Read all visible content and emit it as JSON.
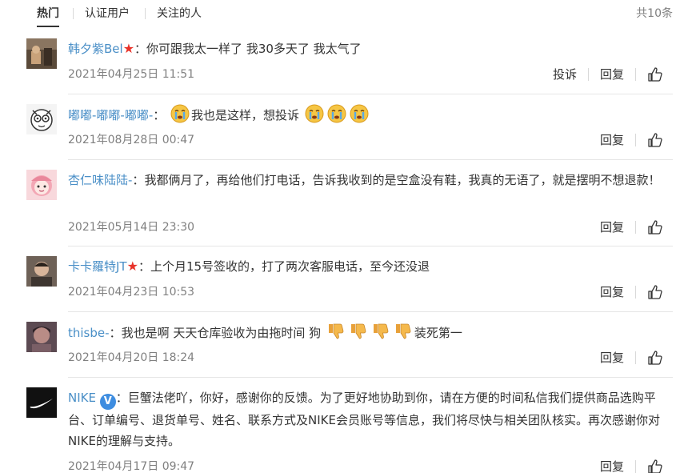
{
  "tabs": [
    {
      "label": "热门",
      "active": true
    },
    {
      "label": "认证用户",
      "active": false
    },
    {
      "label": "关注的人",
      "active": false
    }
  ],
  "total": "共10条",
  "actions": {
    "report": "投诉",
    "reply": "回复",
    "like_icon": "thumbs-up-icon"
  },
  "comments": [
    {
      "username": "韩夕紫Bel",
      "badge": "star",
      "separator": "：",
      "text": "你可跟我太一样了 我30多天了 我太气了",
      "time": "2021年04月25日 11:51"
    },
    {
      "username": "嘟嘟-嘟嘟-嘟嘟-",
      "separator": "：",
      "text_parts": [
        "我也是这样，想投诉"
      ],
      "emoji": "crying-face-icon",
      "time": "2021年08月28日 00:47"
    },
    {
      "username": "杏仁味陆陆-",
      "separator": "：",
      "text": "我都俩月了，再给他们打电话，告诉我收到的是空盒没有鞋，我真的无语了，就是摆明不想退款！",
      "time": "2021年05月14日 23:30"
    },
    {
      "username": "卡卡羅特JT",
      "badge": "star",
      "separator": "：",
      "text": "上个月15号签收的，打了两次客服电话，至今还没退",
      "time": "2021年04月23日 10:53"
    },
    {
      "username": "thisbe-",
      "separator": "：",
      "text_parts": [
        "我也是啊 天天仓库验收为由拖时间 狗",
        "装死第一"
      ],
      "emoji": "thumbs-down-icon",
      "time": "2021年04月20日 18:24"
    },
    {
      "username": "NIKE",
      "badge": "verified",
      "badge_text": "V",
      "separator": "：",
      "text": "巨蟹法佬吖，你好，感谢你的反馈。为了更好地协助到你，请在方便的时间私信我们提供商品选购平台、订单编号、退货单号、姓名、联系方式及NIKE会员账号等信息，我们将尽快与相关团队核实。再次感谢你对NIKE的理解与支持。",
      "time": "2021年04月17日 09:47"
    }
  ],
  "colors": {
    "username": "#4a8fc7",
    "star": "#e8332a",
    "verified": "#3e8de0",
    "timestamp": "#808080"
  }
}
